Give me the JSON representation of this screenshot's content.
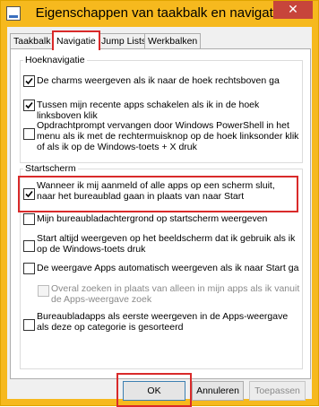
{
  "window": {
    "title": "Eigenschappen van taakbalk en navigatie",
    "close_label": "✕"
  },
  "tabs": [
    {
      "label": "Taakbalk"
    },
    {
      "label": "Navigatie"
    },
    {
      "label": "Jump Lists"
    },
    {
      "label": "Werkbalken"
    }
  ],
  "groups": {
    "hoek": {
      "title": "Hoeknavigatie",
      "items": [
        {
          "label": "De charms weergeven als ik naar de hoek rechtsboven ga",
          "checked": true,
          "enabled": true
        },
        {
          "label": "Tussen mijn recente apps schakelen als ik in de hoek linksboven klik",
          "checked": true,
          "enabled": true
        },
        {
          "label": "Opdrachtprompt vervangen door Windows PowerShell in het menu als ik met de rechtermuisknop op de hoek linksonder klik of als ik op de Windows-toets + X druk",
          "checked": false,
          "enabled": true
        }
      ]
    },
    "start": {
      "title": "Startscherm",
      "items": [
        {
          "label": "Wanneer ik mij aanmeld of alle apps op een scherm sluit, naar het bureaublad gaan in plaats van naar Start",
          "checked": true,
          "enabled": true
        },
        {
          "label": "Mijn bureaubladachtergrond op startscherm weergeven",
          "checked": false,
          "enabled": true
        },
        {
          "label": "Start altijd weergeven op het beeldscherm dat ik gebruik als ik op de Windows-toets druk",
          "checked": false,
          "enabled": true
        },
        {
          "label": "De weergave Apps automatisch weergeven als ik naar Start ga",
          "checked": false,
          "enabled": true
        },
        {
          "label": "Overal zoeken in plaats van alleen in mijn apps als ik vanuit de Apps-weergave zoek",
          "checked": false,
          "enabled": false
        },
        {
          "label": "Bureaubladapps als eerste weergeven in de Apps-weergave als deze op categorie is gesorteerd",
          "checked": false,
          "enabled": true
        }
      ]
    }
  },
  "buttons": {
    "ok": "OK",
    "cancel": "Annuleren",
    "apply": "Toepassen"
  },
  "colors": {
    "frame": "#f6b91e",
    "close": "#c7453b",
    "highlight": "#d92a2a"
  }
}
